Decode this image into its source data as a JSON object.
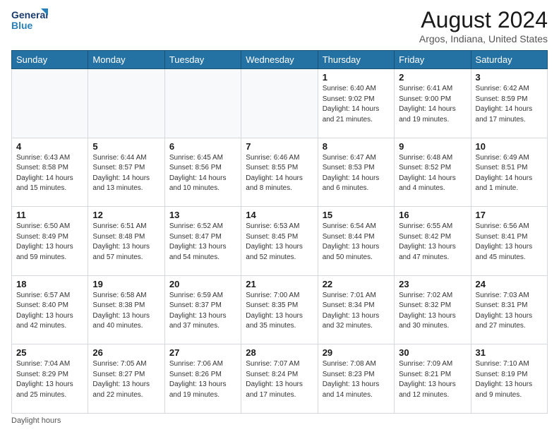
{
  "header": {
    "logo_line1": "General",
    "logo_line2": "Blue",
    "month_title": "August 2024",
    "subtitle": "Argos, Indiana, United States"
  },
  "days_of_week": [
    "Sunday",
    "Monday",
    "Tuesday",
    "Wednesday",
    "Thursday",
    "Friday",
    "Saturday"
  ],
  "weeks": [
    [
      {
        "day": "",
        "info": ""
      },
      {
        "day": "",
        "info": ""
      },
      {
        "day": "",
        "info": ""
      },
      {
        "day": "",
        "info": ""
      },
      {
        "day": "1",
        "info": "Sunrise: 6:40 AM\nSunset: 9:02 PM\nDaylight: 14 hours\nand 21 minutes."
      },
      {
        "day": "2",
        "info": "Sunrise: 6:41 AM\nSunset: 9:00 PM\nDaylight: 14 hours\nand 19 minutes."
      },
      {
        "day": "3",
        "info": "Sunrise: 6:42 AM\nSunset: 8:59 PM\nDaylight: 14 hours\nand 17 minutes."
      }
    ],
    [
      {
        "day": "4",
        "info": "Sunrise: 6:43 AM\nSunset: 8:58 PM\nDaylight: 14 hours\nand 15 minutes."
      },
      {
        "day": "5",
        "info": "Sunrise: 6:44 AM\nSunset: 8:57 PM\nDaylight: 14 hours\nand 13 minutes."
      },
      {
        "day": "6",
        "info": "Sunrise: 6:45 AM\nSunset: 8:56 PM\nDaylight: 14 hours\nand 10 minutes."
      },
      {
        "day": "7",
        "info": "Sunrise: 6:46 AM\nSunset: 8:55 PM\nDaylight: 14 hours\nand 8 minutes."
      },
      {
        "day": "8",
        "info": "Sunrise: 6:47 AM\nSunset: 8:53 PM\nDaylight: 14 hours\nand 6 minutes."
      },
      {
        "day": "9",
        "info": "Sunrise: 6:48 AM\nSunset: 8:52 PM\nDaylight: 14 hours\nand 4 minutes."
      },
      {
        "day": "10",
        "info": "Sunrise: 6:49 AM\nSunset: 8:51 PM\nDaylight: 14 hours\nand 1 minute."
      }
    ],
    [
      {
        "day": "11",
        "info": "Sunrise: 6:50 AM\nSunset: 8:49 PM\nDaylight: 13 hours\nand 59 minutes."
      },
      {
        "day": "12",
        "info": "Sunrise: 6:51 AM\nSunset: 8:48 PM\nDaylight: 13 hours\nand 57 minutes."
      },
      {
        "day": "13",
        "info": "Sunrise: 6:52 AM\nSunset: 8:47 PM\nDaylight: 13 hours\nand 54 minutes."
      },
      {
        "day": "14",
        "info": "Sunrise: 6:53 AM\nSunset: 8:45 PM\nDaylight: 13 hours\nand 52 minutes."
      },
      {
        "day": "15",
        "info": "Sunrise: 6:54 AM\nSunset: 8:44 PM\nDaylight: 13 hours\nand 50 minutes."
      },
      {
        "day": "16",
        "info": "Sunrise: 6:55 AM\nSunset: 8:42 PM\nDaylight: 13 hours\nand 47 minutes."
      },
      {
        "day": "17",
        "info": "Sunrise: 6:56 AM\nSunset: 8:41 PM\nDaylight: 13 hours\nand 45 minutes."
      }
    ],
    [
      {
        "day": "18",
        "info": "Sunrise: 6:57 AM\nSunset: 8:40 PM\nDaylight: 13 hours\nand 42 minutes."
      },
      {
        "day": "19",
        "info": "Sunrise: 6:58 AM\nSunset: 8:38 PM\nDaylight: 13 hours\nand 40 minutes."
      },
      {
        "day": "20",
        "info": "Sunrise: 6:59 AM\nSunset: 8:37 PM\nDaylight: 13 hours\nand 37 minutes."
      },
      {
        "day": "21",
        "info": "Sunrise: 7:00 AM\nSunset: 8:35 PM\nDaylight: 13 hours\nand 35 minutes."
      },
      {
        "day": "22",
        "info": "Sunrise: 7:01 AM\nSunset: 8:34 PM\nDaylight: 13 hours\nand 32 minutes."
      },
      {
        "day": "23",
        "info": "Sunrise: 7:02 AM\nSunset: 8:32 PM\nDaylight: 13 hours\nand 30 minutes."
      },
      {
        "day": "24",
        "info": "Sunrise: 7:03 AM\nSunset: 8:31 PM\nDaylight: 13 hours\nand 27 minutes."
      }
    ],
    [
      {
        "day": "25",
        "info": "Sunrise: 7:04 AM\nSunset: 8:29 PM\nDaylight: 13 hours\nand 25 minutes."
      },
      {
        "day": "26",
        "info": "Sunrise: 7:05 AM\nSunset: 8:27 PM\nDaylight: 13 hours\nand 22 minutes."
      },
      {
        "day": "27",
        "info": "Sunrise: 7:06 AM\nSunset: 8:26 PM\nDaylight: 13 hours\nand 19 minutes."
      },
      {
        "day": "28",
        "info": "Sunrise: 7:07 AM\nSunset: 8:24 PM\nDaylight: 13 hours\nand 17 minutes."
      },
      {
        "day": "29",
        "info": "Sunrise: 7:08 AM\nSunset: 8:23 PM\nDaylight: 13 hours\nand 14 minutes."
      },
      {
        "day": "30",
        "info": "Sunrise: 7:09 AM\nSunset: 8:21 PM\nDaylight: 13 hours\nand 12 minutes."
      },
      {
        "day": "31",
        "info": "Sunrise: 7:10 AM\nSunset: 8:19 PM\nDaylight: 13 hours\nand 9 minutes."
      }
    ]
  ],
  "footer": {
    "note": "Daylight hours"
  }
}
